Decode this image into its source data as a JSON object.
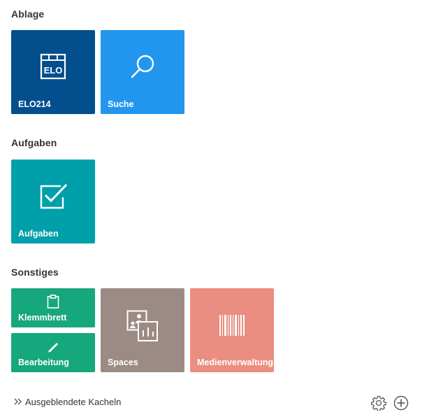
{
  "sections": {
    "ablage": {
      "title": "Ablage"
    },
    "aufgaben": {
      "title": "Aufgaben"
    },
    "sonstiges": {
      "title": "Sonstiges"
    }
  },
  "tiles": {
    "elo": {
      "label": "ELO214",
      "icon": "elo-archive-icon",
      "color": "#034e8d",
      "logo_text": "ELO"
    },
    "suche": {
      "label": "Suche",
      "icon": "search-icon",
      "color": "#2296ef"
    },
    "aufgaben": {
      "label": "Aufgaben",
      "icon": "checkbox-icon",
      "color": "#00a0ab"
    },
    "klemmbrett": {
      "label": "Klemmbrett",
      "icon": "clipboard-icon",
      "color": "#17a77c"
    },
    "bearbeitung": {
      "label": "Bearbeitung",
      "icon": "pencil-icon",
      "color": "#17a77c"
    },
    "spaces": {
      "label": "Spaces",
      "icon": "spaces-cards-icon",
      "color": "#9c8b84"
    },
    "medien": {
      "label": "Medienverwaltung",
      "icon": "barcode-icon",
      "color": "#e98e80"
    }
  },
  "footer": {
    "hidden_tiles_label": "Ausgeblendete Kacheln",
    "hidden_tiles_icon": "double-chevron-right-icon",
    "settings_icon": "gear-icon",
    "add_icon": "add-circle-icon"
  }
}
